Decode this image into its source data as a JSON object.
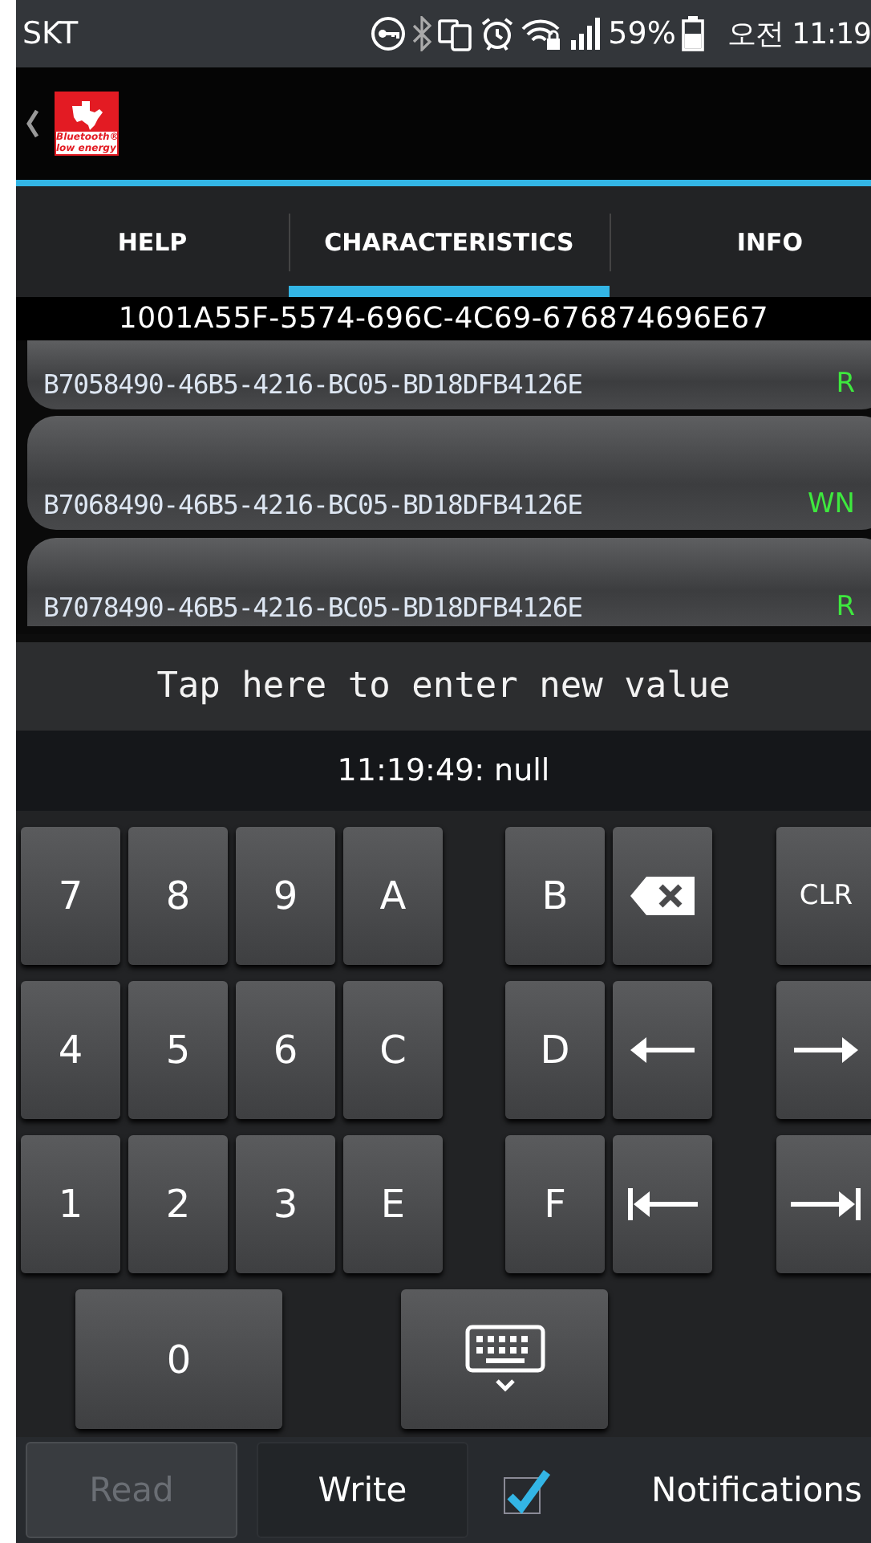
{
  "status_bar": {
    "carrier": "SKT",
    "battery_percent": "59%",
    "time": "오전 11:19"
  },
  "action_bar": {
    "logo_lines": [
      "Bluetooth®",
      "low energy"
    ]
  },
  "tabs": [
    {
      "label": "HELP",
      "selected": false
    },
    {
      "label": "CHARACTERISTICS",
      "selected": true
    },
    {
      "label": "INFO",
      "selected": false
    }
  ],
  "service_uuid": "1001A55F-5574-696C-4C69-676874696E67",
  "characteristics": [
    {
      "uuid": "B7058490-46B5-4216-BC05-BD18DFB4126E",
      "properties": "R"
    },
    {
      "uuid": "B7068490-46B5-4216-BC05-BD18DFB4126E",
      "properties": "WN"
    },
    {
      "uuid": "B7078490-46B5-4216-BC05-BD18DFB4126E",
      "properties": "R"
    }
  ],
  "value_input": {
    "placeholder": "Tap here to enter new value"
  },
  "result": "11:19:49: null",
  "keypad": [
    [
      {
        "kind": "text",
        "label": "7"
      },
      {
        "kind": "text",
        "label": "8"
      },
      {
        "kind": "text",
        "label": "9"
      },
      {
        "kind": "text",
        "label": "A"
      },
      {
        "kind": "text",
        "label": "B"
      },
      {
        "kind": "backspace"
      },
      {
        "kind": "text",
        "label": "CLR"
      }
    ],
    [
      {
        "kind": "text",
        "label": "4"
      },
      {
        "kind": "text",
        "label": "5"
      },
      {
        "kind": "text",
        "label": "6"
      },
      {
        "kind": "text",
        "label": "C"
      },
      {
        "kind": "text",
        "label": "D"
      },
      {
        "kind": "left"
      },
      {
        "kind": "right"
      }
    ],
    [
      {
        "kind": "text",
        "label": "1"
      },
      {
        "kind": "text",
        "label": "2"
      },
      {
        "kind": "text",
        "label": "3"
      },
      {
        "kind": "text",
        "label": "E"
      },
      {
        "kind": "text",
        "label": "F"
      },
      {
        "kind": "home"
      },
      {
        "kind": "end"
      }
    ],
    [
      {
        "kind": "text",
        "label": "0"
      },
      {
        "kind": "keyboard"
      }
    ]
  ],
  "bottom_bar": {
    "read": {
      "label": "Read",
      "disabled": true
    },
    "write": {
      "label": "Write",
      "disabled": false
    },
    "notifications": {
      "label": "Notifications",
      "checked": true
    }
  }
}
